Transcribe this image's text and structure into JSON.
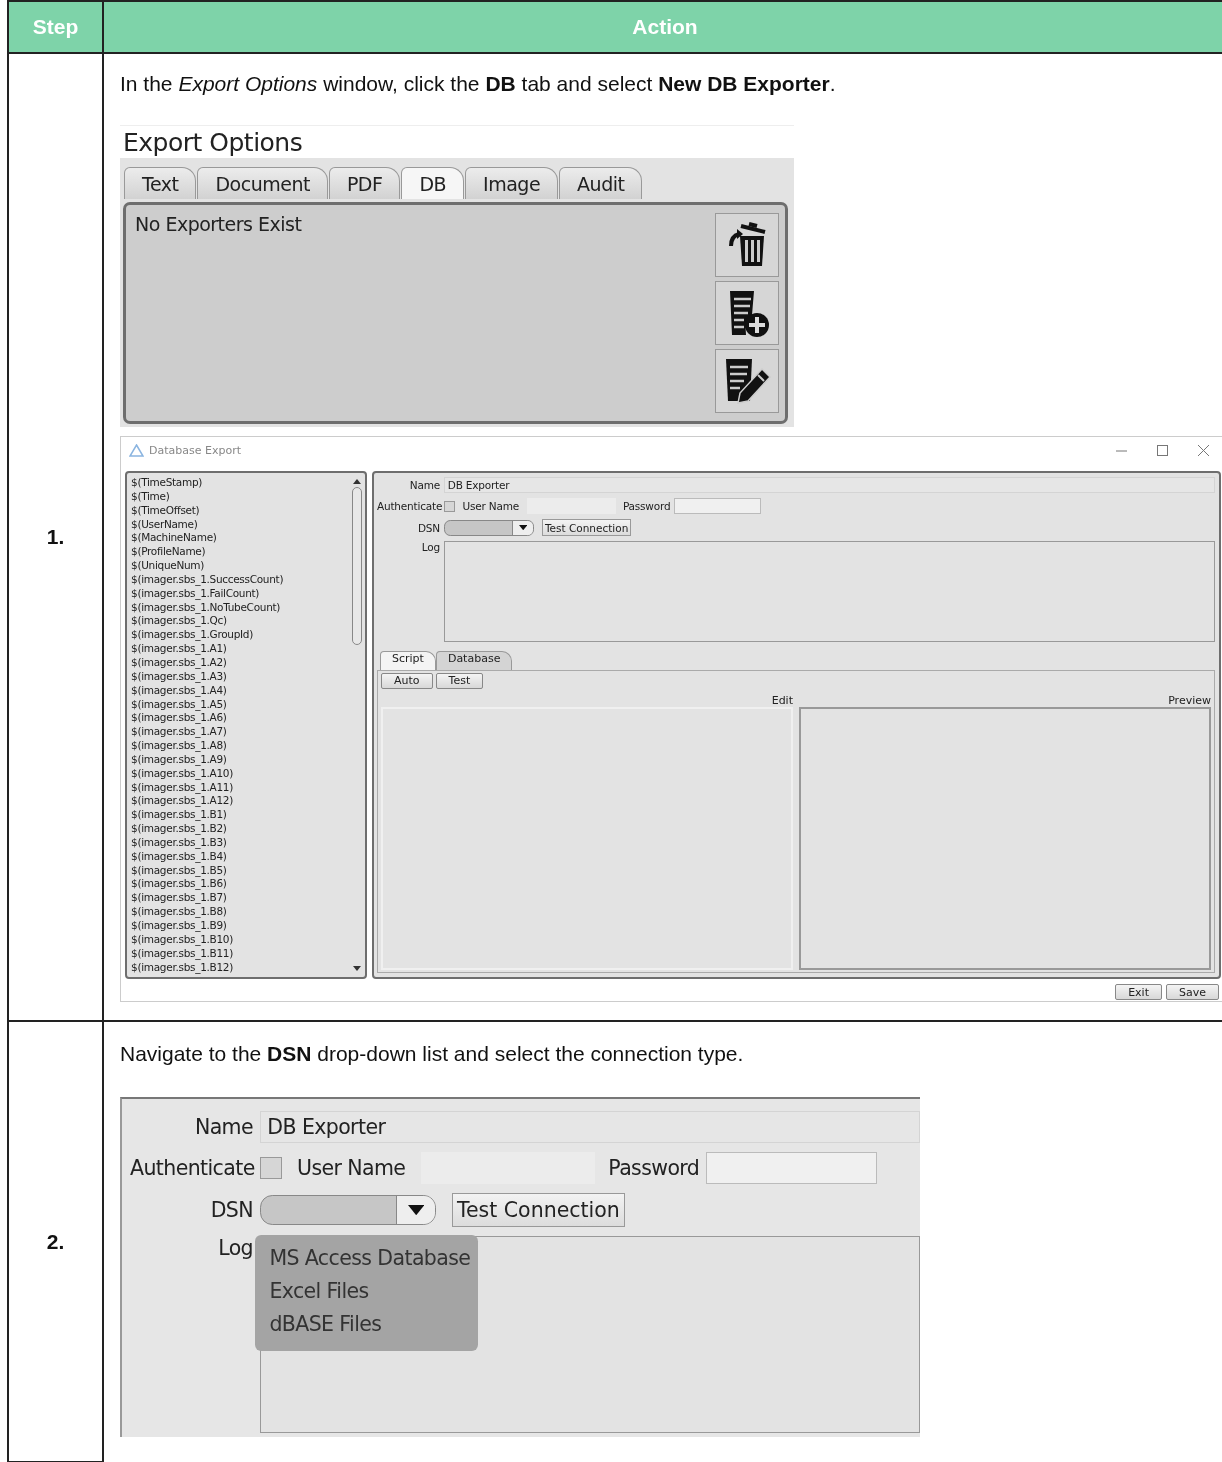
{
  "header": {
    "step": "Step",
    "action": "Action"
  },
  "steps": [
    {
      "number": "1.",
      "instruction": "In the *Export Options* window, click the **DB** tab and select **New DB Exporter**.",
      "export_options": {
        "title": "Export Options",
        "tabs": [
          {
            "label": "Text",
            "selected": false
          },
          {
            "label": "Document",
            "selected": false
          },
          {
            "label": "PDF",
            "selected": false
          },
          {
            "label": "DB",
            "selected": true
          },
          {
            "label": "Image",
            "selected": false
          },
          {
            "label": "Audit",
            "selected": false
          }
        ],
        "message": "No Exporters Exist"
      },
      "database_export": {
        "title": "Database Export",
        "variables": [
          "$(TimeStamp)",
          "$(Time)",
          "$(TimeOffset)",
          "$(UserName)",
          "$(MachineName)",
          "$(ProfileName)",
          "$(UniqueNum)",
          "$(imager.sbs_1.SuccessCount)",
          "$(imager.sbs_1.FailCount)",
          "$(imager.sbs_1.NoTubeCount)",
          "$(imager.sbs_1.Qc)",
          "$(imager.sbs_1.GroupId)",
          "$(imager.sbs_1.A1)",
          "$(imager.sbs_1.A2)",
          "$(imager.sbs_1.A3)",
          "$(imager.sbs_1.A4)",
          "$(imager.sbs_1.A5)",
          "$(imager.sbs_1.A6)",
          "$(imager.sbs_1.A7)",
          "$(imager.sbs_1.A8)",
          "$(imager.sbs_1.A9)",
          "$(imager.sbs_1.A10)",
          "$(imager.sbs_1.A11)",
          "$(imager.sbs_1.A12)",
          "$(imager.sbs_1.B1)",
          "$(imager.sbs_1.B2)",
          "$(imager.sbs_1.B3)",
          "$(imager.sbs_1.B4)",
          "$(imager.sbs_1.B5)",
          "$(imager.sbs_1.B6)",
          "$(imager.sbs_1.B7)",
          "$(imager.sbs_1.B8)",
          "$(imager.sbs_1.B9)",
          "$(imager.sbs_1.B10)",
          "$(imager.sbs_1.B11)",
          "$(imager.sbs_1.B12)"
        ],
        "form": {
          "name_label": "Name",
          "name_value": "DB Exporter",
          "authenticate_label": "Authenticate",
          "authenticate_checked": false,
          "user_name_label": "User Name",
          "password_label": "Password",
          "dsn_label": "DSN",
          "test_connection": "Test Connection",
          "log_label": "Log"
        },
        "editor_tabs": [
          {
            "label": "Script",
            "selected": true
          },
          {
            "label": "Database",
            "selected": false
          }
        ],
        "editor_buttons": [
          "Auto",
          "Test"
        ],
        "edit_label": "Edit",
        "preview_label": "Preview",
        "buttons": [
          "Exit",
          "Save"
        ]
      }
    },
    {
      "number": "2.",
      "instruction": "Navigate to the **DSN** drop-down list and select the connection type.",
      "form": {
        "name_label": "Name",
        "name_value": "DB Exporter",
        "authenticate_label": "Authenticate",
        "authenticate_checked": false,
        "user_name_label": "User Name",
        "password_label": "Password",
        "dsn_label": "DSN",
        "test_connection": "Test Connection",
        "log_label": "Log",
        "dsn_options": [
          "MS Access Database",
          "Excel Files",
          "dBASE Files"
        ]
      }
    }
  ]
}
